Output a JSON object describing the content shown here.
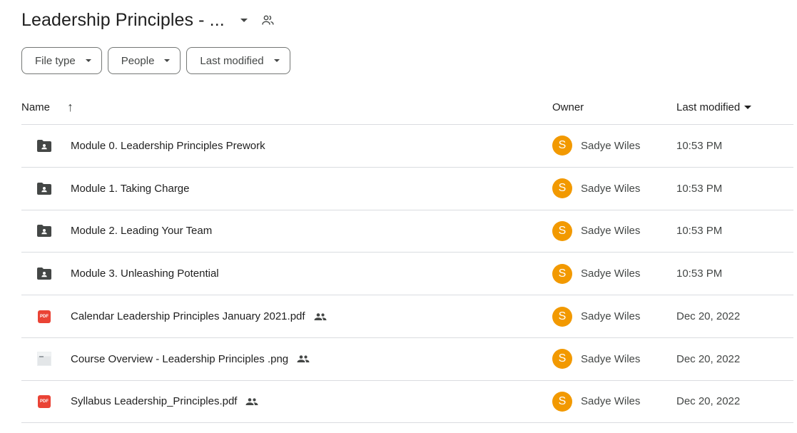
{
  "header": {
    "title": "Leadership Principles - ...",
    "title_dropdown_icon": "caret-down-icon",
    "shared_icon": "shared-folder-people-icon"
  },
  "filters": [
    {
      "label": "File type"
    },
    {
      "label": "People"
    },
    {
      "label": "Last modified"
    }
  ],
  "columns": {
    "name": "Name",
    "name_sort_icon": "arrow-up-icon",
    "owner": "Owner",
    "last_modified": "Last modified"
  },
  "files": [
    {
      "name": "Module 0. Leadership Principles Prework",
      "type": "shared-folder",
      "shared": false,
      "owner": "Sadye Wiles",
      "owner_initial": "S",
      "modified": "10:53 PM"
    },
    {
      "name": "Module 1. Taking Charge",
      "type": "shared-folder",
      "shared": false,
      "owner": "Sadye Wiles",
      "owner_initial": "S",
      "modified": "10:53 PM"
    },
    {
      "name": "Module 2. Leading Your Team",
      "type": "shared-folder",
      "shared": false,
      "owner": "Sadye Wiles",
      "owner_initial": "S",
      "modified": "10:53 PM"
    },
    {
      "name": "Module 3. Unleashing Potential",
      "type": "shared-folder",
      "shared": false,
      "owner": "Sadye Wiles",
      "owner_initial": "S",
      "modified": "10:53 PM"
    },
    {
      "name": "Calendar Leadership Principles January 2021.pdf",
      "type": "pdf",
      "shared": true,
      "owner": "Sadye Wiles",
      "owner_initial": "S",
      "modified": "Dec 20, 2022"
    },
    {
      "name": "Course Overview - Leadership Principles .png",
      "type": "image",
      "shared": true,
      "owner": "Sadye Wiles",
      "owner_initial": "S",
      "modified": "Dec 20, 2022"
    },
    {
      "name": "Syllabus Leadership_Principles.pdf",
      "type": "pdf",
      "shared": true,
      "owner": "Sadye Wiles",
      "owner_initial": "S",
      "modified": "Dec 20, 2022"
    }
  ],
  "labels": {
    "pdf_badge": "PDF"
  },
  "colors": {
    "avatar": "#f29900",
    "pdf": "#ea4335",
    "folder": "#444746"
  }
}
